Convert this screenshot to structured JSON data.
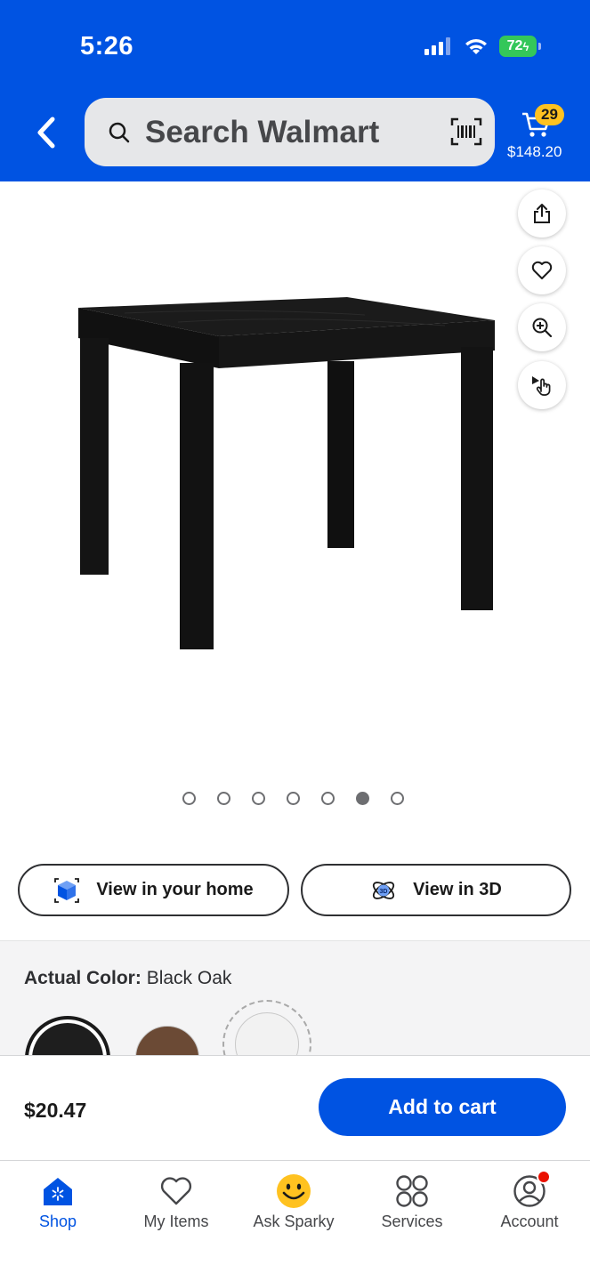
{
  "status_bar": {
    "time": "5:26",
    "battery": "72"
  },
  "search": {
    "placeholder": "Search Walmart"
  },
  "cart": {
    "count": "29",
    "total": "$148.20"
  },
  "carousel": {
    "total_images": 7,
    "active_index": 5
  },
  "view_buttons": {
    "home_label": "View in your home",
    "three_d_label": "View in 3D"
  },
  "color": {
    "label": "Actual Color:",
    "value": "Black Oak",
    "swatches": [
      {
        "name": "Black Oak",
        "color": "#1e1e1e",
        "selected": true
      },
      {
        "name": "Walnut",
        "color": "#6b4a35",
        "selected": false
      },
      {
        "name": "White",
        "color": "#f2f2f2",
        "selected": false
      }
    ]
  },
  "purchase": {
    "price": "$20.47",
    "add_to_cart": "Add to cart"
  },
  "tabs": [
    {
      "label": "Shop",
      "icon": "walmart-shop-icon",
      "active": true
    },
    {
      "label": "My Items",
      "icon": "heart-icon",
      "active": false
    },
    {
      "label": "Ask Sparky",
      "icon": "sparky-smiley-icon",
      "active": false
    },
    {
      "label": "Services",
      "icon": "services-grid-icon",
      "active": false
    },
    {
      "label": "Account",
      "icon": "account-icon",
      "active": false
    }
  ],
  "colors": {
    "brand_blue": "#0053e2",
    "spark_yellow": "#ffc220",
    "alert_red": "#ea1100"
  }
}
